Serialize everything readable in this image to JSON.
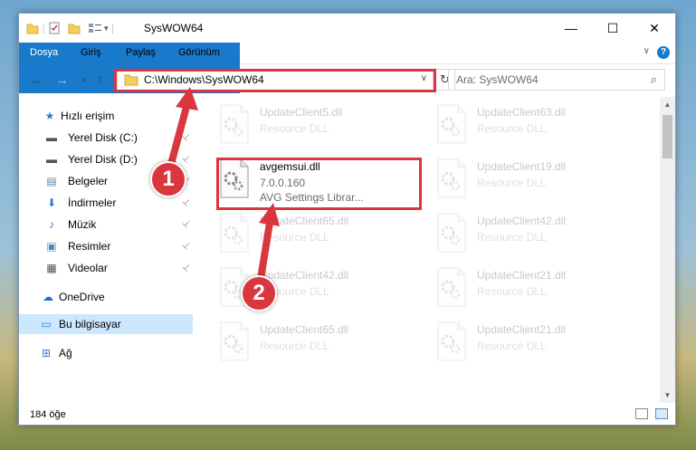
{
  "window": {
    "title": "SysWOW64",
    "minimize": "—",
    "maximize": "☐",
    "close": "✕"
  },
  "ribbon": {
    "tabs": [
      "Dosya",
      "Giriş",
      "Paylaş",
      "Görünüm"
    ],
    "help": "?",
    "expand": "∨"
  },
  "nav": {
    "back": "←",
    "forward": "→",
    "recent": "∨",
    "up": "↑",
    "address": "C:\\Windows\\SysWOW64",
    "address_dropdown": "∨",
    "refresh": "↻",
    "search_placeholder": "Ara: SysWOW64",
    "search_icon": "⌕"
  },
  "sidebar": {
    "items": [
      {
        "label": "Hızlı erişim",
        "icon": "star-icon",
        "glyph": "★",
        "color": "#2b7bd6",
        "pinned": false
      },
      {
        "label": "Yerel Disk (C:)",
        "icon": "drive-icon",
        "glyph": "▬",
        "color": "#555555",
        "pinned": true
      },
      {
        "label": "Yerel Disk (D:)",
        "icon": "drive-icon",
        "glyph": "▬",
        "color": "#555555",
        "pinned": true
      },
      {
        "label": "Belgeler",
        "icon": "documents-icon",
        "glyph": "▤",
        "color": "#5b7fa8",
        "pinned": true
      },
      {
        "label": "İndirmeler",
        "icon": "downloads-icon",
        "glyph": "⬇",
        "color": "#2b7bd6",
        "pinned": true
      },
      {
        "label": "Müzik",
        "icon": "music-icon",
        "glyph": "♪",
        "color": "#2b7bd6",
        "pinned": true
      },
      {
        "label": "Resimler",
        "icon": "pictures-icon",
        "glyph": "▣",
        "color": "#4a8ac4",
        "pinned": true
      },
      {
        "label": "Videolar",
        "icon": "videos-icon",
        "glyph": "▦",
        "color": "#555555",
        "pinned": true
      },
      {
        "label": "OneDrive",
        "icon": "onedrive-icon",
        "glyph": "☁",
        "color": "#1c6fd1",
        "pinned": false
      },
      {
        "label": "Bu bilgisayar",
        "icon": "computer-icon",
        "glyph": "▭",
        "color": "#2b7bd6",
        "pinned": false
      },
      {
        "label": "Ağ",
        "icon": "network-icon",
        "glyph": "⊞",
        "color": "#2b7bd6",
        "pinned": false
      }
    ],
    "pin_glyph": "📌"
  },
  "files": {
    "left": [
      {
        "name": "UpdateClient5.dll",
        "desc": "Resource DLL"
      },
      {
        "name": "avgemsui.dll",
        "desc": "7.0.0.160",
        "desc2": "AVG Settings Librar..."
      },
      {
        "name": "UpdateClient65.dll",
        "desc": "Resource DLL"
      },
      {
        "name": "UpdateClient42.dll",
        "desc": "Resource DLL"
      },
      {
        "name": "UpdateClient65.dll",
        "desc": "Resource DLL"
      }
    ],
    "right": [
      {
        "name": "UpdateClient63.dll",
        "desc": "Resource DLL"
      },
      {
        "name": "UpdateClient19.dll",
        "desc": "Resource DLL"
      },
      {
        "name": "UpdateClient42.dll",
        "desc": "Resource DLL"
      },
      {
        "name": "UpdateClient21.dll",
        "desc": "Resource DLL"
      },
      {
        "name": "UpdateClient21.dll",
        "desc": "Resource DLL"
      }
    ]
  },
  "status": {
    "count": "184 öğe"
  },
  "annotations": {
    "step1": "1",
    "step2": "2"
  },
  "colors": {
    "accent": "#1979ca",
    "highlight": "#d9363e",
    "selected": "#cce8ff"
  }
}
